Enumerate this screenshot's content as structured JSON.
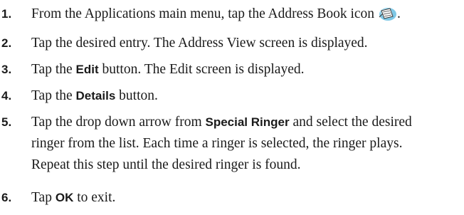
{
  "steps": [
    {
      "number": "1.",
      "parts": {
        "a": "From the Applications main menu, tap the Address Book icon",
        "b": "."
      },
      "icon": "address-book-icon"
    },
    {
      "number": "2.",
      "parts": {
        "a": "Tap the desired entry. The Address View screen is displayed."
      }
    },
    {
      "number": "3.",
      "parts": {
        "a": "Tap the ",
        "bold": "Edit",
        "b": " button. The Edit screen is displayed."
      }
    },
    {
      "number": "4.",
      "parts": {
        "a": "Tap the ",
        "bold": "Details",
        "b": " button."
      }
    },
    {
      "number": "5.",
      "lines": {
        "l1a": "Tap the drop down arrow from ",
        "l1bold": "Special Ringer",
        "l1b": " and select the desired",
        "l2": "ringer from the list. Each time a ringer is selected, the ringer plays.",
        "l3": "Repeat this step until the desired ringer is found."
      }
    },
    {
      "number": "6.",
      "parts": {
        "a": "Tap ",
        "bold": "OK",
        "b": " to exit."
      }
    }
  ]
}
